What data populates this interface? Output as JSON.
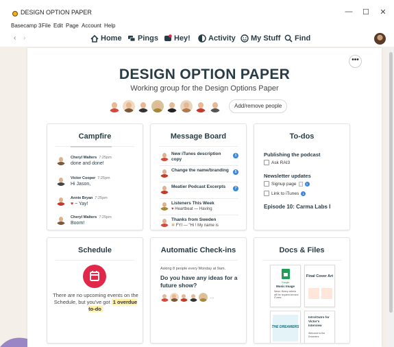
{
  "window": {
    "title": "DESIGN OPTION PAPER",
    "minimize": "—",
    "maximize": "☐",
    "close": "✕"
  },
  "menubar": [
    "Basecamp 3",
    "File",
    "Edit",
    "Page",
    "Account",
    "Help"
  ],
  "nav": {
    "back": "‹",
    "forward": "›",
    "items": [
      "Home",
      "Pings",
      "Hey!",
      "Activity",
      "My Stuff",
      "Find"
    ]
  },
  "project": {
    "title": "DESIGN OPTION PAPER",
    "subtitle": "Working group for the Design Options Paper",
    "more": "•••",
    "add_people": "Add/remove people"
  },
  "campfire": {
    "title": "Campfire",
    "messages": [
      {
        "name": "Cheryl Walters",
        "time": "7:25pm",
        "text": "done and done!"
      },
      {
        "name": "Victor Cooper",
        "time": "7:25pm",
        "text": "Hi Jason,"
      },
      {
        "name": "Annie Bryan",
        "time": "7:25pm",
        "text": "~ Yay!"
      },
      {
        "name": "Cheryl Walters",
        "time": "7:25pm",
        "text": "Boom!"
      }
    ]
  },
  "message_board": {
    "title": "Message Board",
    "messages": [
      {
        "title": "New iTunes description copy",
        "sub": "",
        "count": "1"
      },
      {
        "title": "Change the name/branding",
        "sub": "",
        "count": "5"
      },
      {
        "title": "Meatier Podcast Excerpts",
        "sub": "",
        "count": "7"
      },
      {
        "title": "Listeners This Week",
        "sub": "Heartbeat — Having",
        "count": ""
      },
      {
        "title": "Thanks from Sweden",
        "sub": "FYI — \"Hi ! My name is",
        "count": ""
      }
    ]
  },
  "todos": {
    "title": "To-dos",
    "lists": [
      {
        "name": "Publishing the podcast",
        "items": [
          "Ask RAI3"
        ]
      },
      {
        "name": "Newsletter updates",
        "items": [
          "Signup page",
          "Link to iTunes"
        ]
      }
    ],
    "episode": "Episode 10: Carma Labs I",
    "badge_count": "1"
  },
  "schedule": {
    "title": "Schedule",
    "text": "There are no upcoming events on the Schedule, but you've got",
    "overdue": "1 overdue to-do"
  },
  "checkins": {
    "title": "Automatic Check-ins",
    "meta": "Asking 8 people every Monday at 9am.",
    "question": "Do you have any ideas for a future show?",
    "more": "…"
  },
  "docs": {
    "title": "Docs & Files",
    "tiles": [
      {
        "label": "Music Image",
        "kind": "Google"
      },
      {
        "label": "Final Cover Art"
      },
      {
        "label": "THE DREAMERS"
      },
      {
        "label": "Intro/Outro for Victor's Interview"
      }
    ],
    "news_text": "News: Heavy criteria will be required around iTunes",
    "intro_text": "Welcome to the Dreamers"
  },
  "colors": {
    "accent_blue": "#3a86d8",
    "schedule_red": "#e0294a",
    "overdue_highlight": "#fff2a8",
    "text_dark": "#283c46",
    "background": "#f4efe9"
  }
}
